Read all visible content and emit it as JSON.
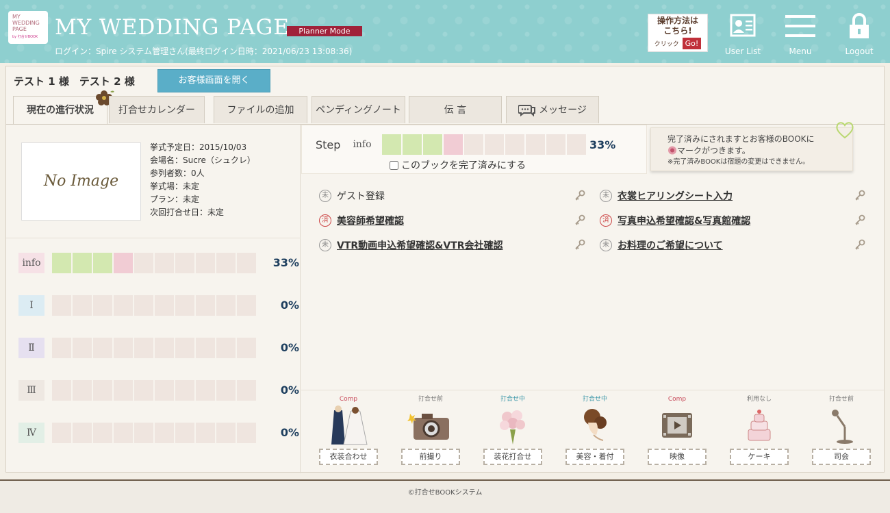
{
  "header": {
    "logo_line1": "MY",
    "logo_line2": "WEDDING",
    "logo_line3": "PAGE",
    "logo_sub": "by 打合せBOOK",
    "title": "MY WEDDING PAGE",
    "mode": "Planner Mode",
    "login_info": "ログイン：Spire システム管理さん(最終ログイン日時：2021/06/23 13:08:36)",
    "help_line1": "操作方法は",
    "help_line2": "こちら!",
    "help_click": "クリック",
    "help_go": "Go!",
    "nav": {
      "user_list": "User List",
      "menu": "Menu",
      "logout": "Logout"
    }
  },
  "couple_name": "テスト 1 様　テスト 2 様",
  "open_customer_button": "お客様画面を開く",
  "tabs": [
    {
      "label": "現在の進行状況"
    },
    {
      "label": "打合せカレンダー"
    },
    {
      "label": "ファイルの追加"
    },
    {
      "label": "ペンディングノート"
    },
    {
      "label": "伝 言"
    },
    {
      "label": "メッセージ"
    }
  ],
  "left": {
    "no_image": "No Image",
    "details": [
      "挙式予定日：2015/10/03",
      "会場名：Sucre（シュクレ）",
      "参列者数：0人",
      "挙式場：未定",
      "プラン：未定",
      "次回打合せ日：未定"
    ],
    "progress": [
      {
        "label": "info",
        "percent": "33%",
        "green": 3,
        "pink": 1
      },
      {
        "label": "Ⅰ",
        "percent": "0%",
        "green": 0,
        "pink": 0
      },
      {
        "label": "Ⅱ",
        "percent": "0%",
        "green": 0,
        "pink": 0
      },
      {
        "label": "Ⅲ",
        "percent": "0%",
        "green": 0,
        "pink": 0
      },
      {
        "label": "Ⅳ",
        "percent": "0%",
        "green": 0,
        "pink": 0
      }
    ]
  },
  "step": {
    "label": "Step",
    "info": "info",
    "percent": "33%",
    "complete_checkbox": "このブックを完了済みにする",
    "note_line1": "完了済みにされますとお客様のBOOKに",
    "note_line2": "マークがつきます。",
    "note_line3": "※完了済みBOOKは宿題の変更はできません。"
  },
  "tasks": [
    {
      "status": "未",
      "label": "ゲスト登録",
      "link": false
    },
    {
      "status": "未",
      "label": "衣裳ヒアリングシート入力",
      "link": true
    },
    {
      "status": "済",
      "label": "美容師希望確認",
      "link": true
    },
    {
      "status": "済",
      "label": "写真申込希望確認&写真館確認",
      "link": true
    },
    {
      "status": "未",
      "label": "VTR動画申込希望確認&VTR会社確認",
      "link": true
    },
    {
      "status": "未",
      "label": "お料理のご希望について",
      "link": true
    }
  ],
  "categories": [
    {
      "stamp": "Comp",
      "label": "衣装合わせ",
      "icon": "dress-icon"
    },
    {
      "stamp": "打合せ前",
      "label": "前撮り",
      "icon": "camera-icon"
    },
    {
      "stamp": "打合せ中",
      "label": "装花打合せ",
      "icon": "bouquet-icon"
    },
    {
      "stamp": "打合せ中",
      "label": "美容・着付",
      "icon": "hair-icon"
    },
    {
      "stamp": "Comp",
      "label": "映像",
      "icon": "video-icon"
    },
    {
      "stamp": "利用なし",
      "label": "ケーキ",
      "icon": "cake-icon"
    },
    {
      "stamp": "打合せ前",
      "label": "司会",
      "icon": "microphone-icon"
    }
  ],
  "footer": "©打合せBOOKシステム"
}
